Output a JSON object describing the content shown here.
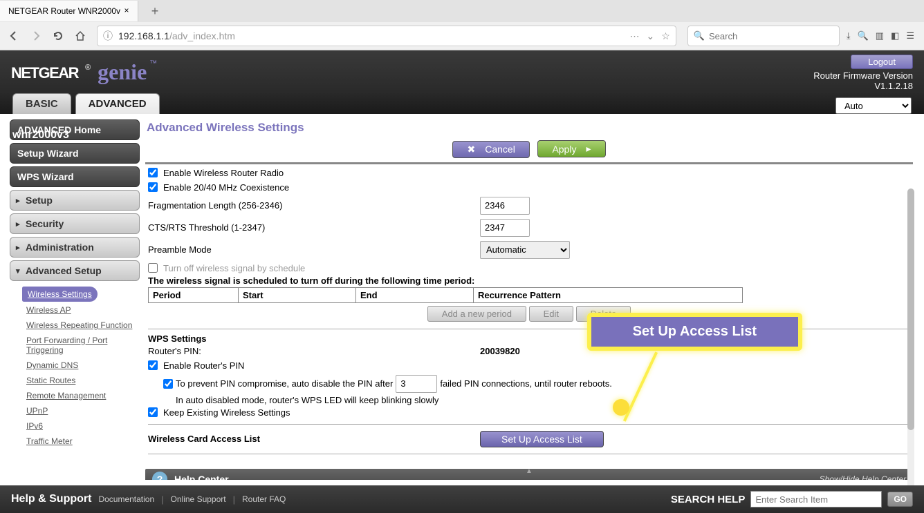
{
  "browser": {
    "tab_title": "NETGEAR Router WNR2000v",
    "url_host": "192.168.1.1",
    "url_path": "/adv_index.htm",
    "search_placeholder": "Search"
  },
  "header": {
    "netgear": "NETGEAR",
    "genie": "genie",
    "model": "wnr2000v3",
    "logout": "Logout",
    "fw_label": "Router Firmware Version",
    "fw_version": "V1.1.2.18"
  },
  "tabs": {
    "basic": "BASIC",
    "advanced": "ADVANCED",
    "auto": "Auto"
  },
  "sidebar": {
    "adv_home": "ADVANCED Home",
    "setup_wizard": "Setup Wizard",
    "wps_wizard": "WPS Wizard",
    "setup": "Setup",
    "security": "Security",
    "administration": "Administration",
    "advanced_setup": "Advanced Setup",
    "subs": {
      "wireless_settings": "Wireless Settings",
      "wireless_ap": "Wireless AP",
      "wrf": "Wireless Repeating Function",
      "pf": "Port Forwarding / Port Triggering",
      "ddns": "Dynamic DNS",
      "static": "Static Routes",
      "remote": "Remote Management",
      "upnp": "UPnP",
      "ipv6": "IPv6",
      "traffic": "Traffic Meter"
    }
  },
  "page": {
    "title": "Advanced Wireless Settings",
    "cancel": "Cancel",
    "apply": "Apply",
    "enable_radio": "Enable Wireless Router Radio",
    "enable_coex": "Enable 20/40 MHz Coexistence",
    "frag_label": "Fragmentation Length (256-2346)",
    "frag_value": "2346",
    "cts_label": "CTS/RTS Threshold (1-2347)",
    "cts_value": "2347",
    "preamble_label": "Preamble Mode",
    "preamble_value": "Automatic",
    "turn_off_sched": "Turn off wireless signal by schedule",
    "sched_desc": "The wireless signal is scheduled to turn off during the following time period:",
    "th_period": "Period",
    "th_start": "Start",
    "th_end": "End",
    "th_recur": "Recurrence Pattern",
    "add_period": "Add a new period",
    "edit": "Edit",
    "delete": "Delete",
    "wps_heading": "WPS Settings",
    "router_pin_label": "Router's PIN:",
    "router_pin_value": "20039820",
    "enable_pin": "Enable Router's PIN",
    "prevent_pre": "To prevent PIN compromise, auto disable the PIN after",
    "prevent_value": "3",
    "prevent_post": "failed PIN connections, until router reboots.",
    "auto_disabled_note": "In auto disabled mode, router's WPS LED will keep blinking slowly",
    "keep_existing": "Keep Existing Wireless Settings",
    "wcal_label": "Wireless Card Access List",
    "setup_access": "Set Up Access List",
    "callout": "Set Up Access List"
  },
  "help": {
    "help_center": "Help Center",
    "show_hide": "Show/Hide Help Center"
  },
  "footer": {
    "title": "Help & Support",
    "doc": "Documentation",
    "online": "Online Support",
    "faq": "Router FAQ",
    "search_label": "SEARCH HELP",
    "search_placeholder": "Enter Search Item",
    "go": "GO"
  }
}
